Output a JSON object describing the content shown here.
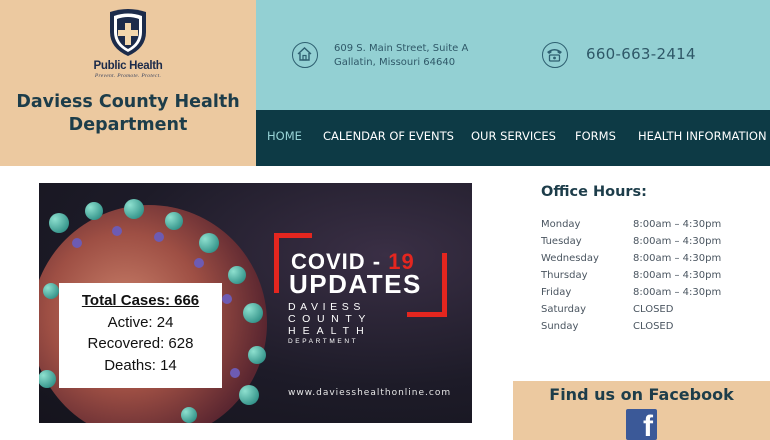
{
  "brand": {
    "logo_word": "Public Health",
    "logo_tagline": "Prevent. Promote. Protect.",
    "org_name_line1": "Daviess County Health",
    "org_name_line2": "Department"
  },
  "contact": {
    "address_line1": "609 S. Main Street, Suite A",
    "address_line2": "Gallatin, Missouri  64640",
    "phone": "660-663-2414"
  },
  "nav": {
    "items": [
      {
        "label": "HOME",
        "active": true
      },
      {
        "label": "CALENDAR OF EVENTS",
        "active": false
      },
      {
        "label": "OUR SERVICES",
        "active": false
      },
      {
        "label": "FORMS",
        "active": false
      },
      {
        "label": "HEALTH INFORMATION",
        "active": false
      }
    ]
  },
  "covid_banner": {
    "total_cases": "Total Cases: 666",
    "active": "Active: 24",
    "recovered": "Recovered: 628",
    "deaths": "Deaths: 14",
    "title_prefix": "COVID - ",
    "title_number": "19",
    "title_line2": "UPDATES",
    "dept_line1": "DAVIESS",
    "dept_line2": "COUNTY",
    "dept_line3": "HEALTH",
    "dept_line4": "DEPARTMENT",
    "url": "www.daviesshealthonline.com"
  },
  "office_hours": {
    "title": "Office Hours:",
    "rows": [
      {
        "day": "Monday",
        "hours": "8:00am – 4:30pm"
      },
      {
        "day": "Tuesday",
        "hours": "8:00am – 4:30pm"
      },
      {
        "day": "Wednesday",
        "hours": "8:00am – 4:30pm"
      },
      {
        "day": "Thursday",
        "hours": "8:00am – 4:30pm"
      },
      {
        "day": "Friday",
        "hours": "8:00am – 4:30pm"
      },
      {
        "day": "Saturday",
        "hours": "CLOSED"
      },
      {
        "day": "Sunday",
        "hours": "CLOSED"
      }
    ]
  },
  "facebook": {
    "title": "Find us on Facebook",
    "icon": "facebook-icon",
    "glyph": "f"
  },
  "colors": {
    "brand_tan": "#ecc9a0",
    "info_teal": "#93d0d3",
    "nav_dark": "#0d3a45",
    "accent_red": "#e4261f",
    "facebook_blue": "#3b5998"
  }
}
